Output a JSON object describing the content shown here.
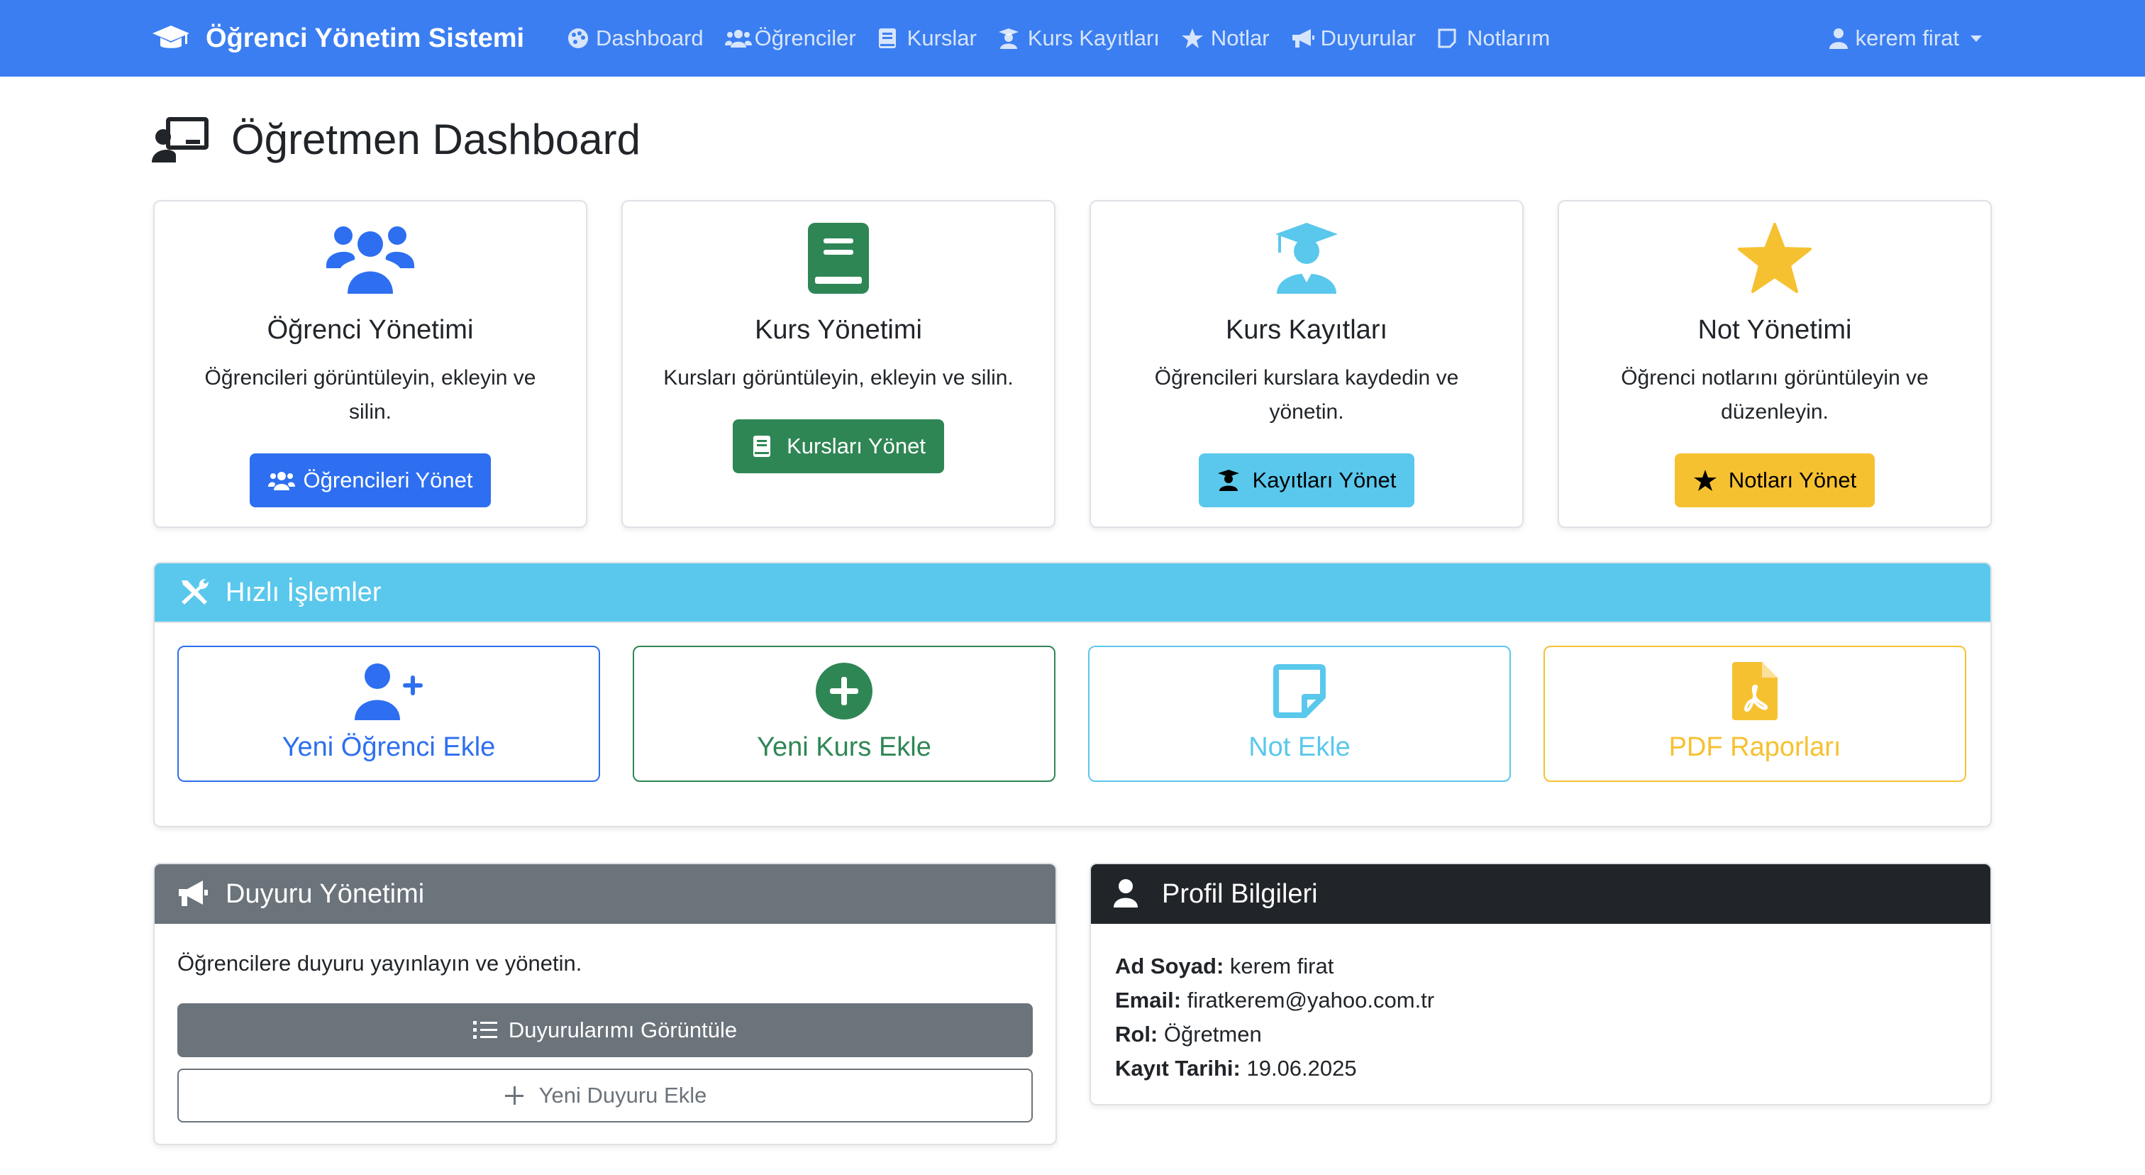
{
  "navbar": {
    "brand": "Öğrenci Yönetim Sistemi",
    "items": [
      {
        "label": "Dashboard",
        "icon": "palette-icon"
      },
      {
        "label": "Öğrenciler",
        "icon": "users-icon"
      },
      {
        "label": "Kurslar",
        "icon": "book-icon"
      },
      {
        "label": "Kurs Kayıtları",
        "icon": "graduate-icon"
      },
      {
        "label": "Notlar",
        "icon": "star-icon"
      },
      {
        "label": "Duyurular",
        "icon": "megaphone-icon"
      },
      {
        "label": "Notlarım",
        "icon": "note-icon"
      }
    ],
    "user": "kerem firat"
  },
  "page": {
    "title": "Öğretmen Dashboard"
  },
  "cards": [
    {
      "title": "Öğrenci Yönetimi",
      "desc": "Öğrencileri görüntüleyin, ekleyin ve silin.",
      "button": "Öğrencileri Yönet",
      "color": "#2d6ff0"
    },
    {
      "title": "Kurs Yönetimi",
      "desc": "Kursları görüntüleyin, ekleyin ve silin.",
      "button": "Kursları Yönet",
      "color": "#2f8655"
    },
    {
      "title": "Kurs Kayıtları",
      "desc": "Öğrencileri kurslara kaydedin ve yönetin.",
      "button": "Kayıtları Yönet",
      "color": "#5ac8ec"
    },
    {
      "title": "Not Yönetimi",
      "desc": "Öğrenci notlarını görüntüleyin ve düzenleyin.",
      "button": "Notları Yönet",
      "color": "#f6c131"
    }
  ],
  "quick_actions": {
    "title": "Hızlı İşlemler",
    "items": [
      {
        "label": "Yeni Öğrenci Ekle",
        "color": "#2d6ff0"
      },
      {
        "label": "Yeni Kurs Ekle",
        "color": "#2f8655"
      },
      {
        "label": "Not Ekle",
        "color": "#5ac8ec"
      },
      {
        "label": "PDF Raporları",
        "color": "#f6c131"
      }
    ]
  },
  "duyuru": {
    "title": "Duyuru Yönetimi",
    "text": "Öğrencilere duyuru yayınlayın ve yönetin.",
    "view_button": "Duyurularımı Görüntüle",
    "add_button": "Yeni Duyuru Ekle"
  },
  "profile": {
    "title": "Profil Bilgileri",
    "fields": [
      {
        "label": "Ad Soyad:",
        "value": "kerem firat"
      },
      {
        "label": "Email:",
        "value": "firatkerem@yahoo.com.tr"
      },
      {
        "label": "Rol:",
        "value": "Öğretmen"
      },
      {
        "label": "Kayıt Tarihi:",
        "value": "19.06.2025"
      }
    ]
  }
}
